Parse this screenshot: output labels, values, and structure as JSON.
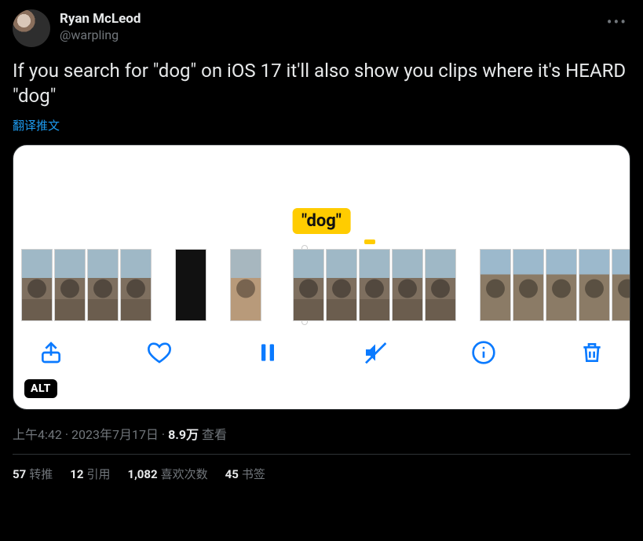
{
  "author": {
    "display_name": "Ryan McLeod",
    "handle": "@warpling"
  },
  "more_label": "•••",
  "body_text": "If you search for \"dog\" on iOS 17 it'll also show you clips where it's HEARD \"dog\"",
  "translate_label": "翻译推文",
  "media": {
    "search_tag": "\"dog\"",
    "alt_badge": "ALT",
    "toolbar": {
      "share": "share",
      "like": "like",
      "pause": "pause",
      "mute": "mute",
      "info": "info",
      "trash": "trash"
    }
  },
  "meta": {
    "time": "上午4:42",
    "dot1": " · ",
    "date": "2023年7月17日",
    "dot2": " · ",
    "views_count": "8.9万",
    "views_label": " 查看"
  },
  "stats": {
    "retweets_count": "57",
    "retweets_label": "转推",
    "quotes_count": "12",
    "quotes_label": "引用",
    "likes_count": "1,082",
    "likes_label": "喜欢次数",
    "bookmarks_count": "45",
    "bookmarks_label": "书签"
  }
}
